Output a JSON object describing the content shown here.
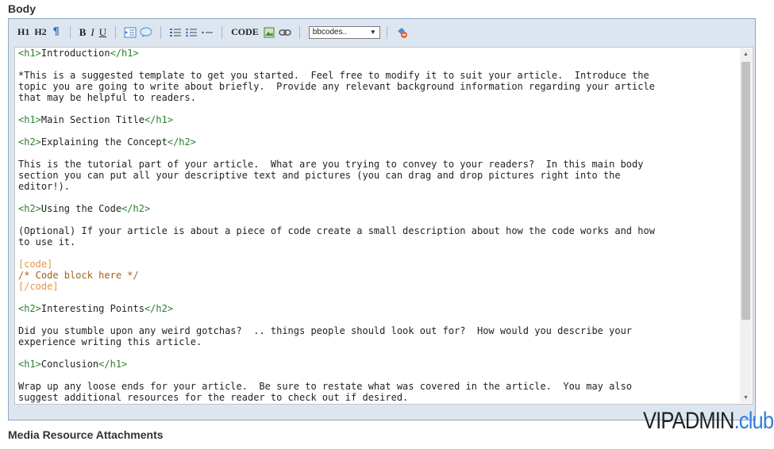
{
  "body_title": "Body",
  "media_title": "Media Resource Attachments",
  "toolbar": {
    "h1": "H1",
    "h2": "H2",
    "bold": "B",
    "italic": "I",
    "underline": "U",
    "code": "CODE",
    "select_value": "bbcodes.."
  },
  "editor_lines": [
    {
      "parts": [
        {
          "t": "<h1>",
          "c": "tag"
        },
        {
          "t": "Introduction"
        },
        {
          "t": "</h1>",
          "c": "tag"
        }
      ]
    },
    {
      "parts": []
    },
    {
      "parts": [
        {
          "t": "*This is a suggested template to get you started.  Feel free to modify it to suit your article.  Introduce the"
        }
      ]
    },
    {
      "parts": [
        {
          "t": "topic you are going to write about briefly.  Provide any relevant background information regarding your article"
        }
      ]
    },
    {
      "parts": [
        {
          "t": "that may be helpful to readers."
        }
      ]
    },
    {
      "parts": []
    },
    {
      "parts": [
        {
          "t": "<h1>",
          "c": "tag"
        },
        {
          "t": "Main Section Title"
        },
        {
          "t": "</h1>",
          "c": "tag"
        }
      ]
    },
    {
      "parts": []
    },
    {
      "parts": [
        {
          "t": "<h2>",
          "c": "tag"
        },
        {
          "t": "Explaining the Concept"
        },
        {
          "t": "</h2>",
          "c": "tag"
        }
      ]
    },
    {
      "parts": []
    },
    {
      "parts": [
        {
          "t": "This is the tutorial part of your article.  What are you trying to convey to your readers?  In this main body"
        }
      ]
    },
    {
      "parts": [
        {
          "t": "section you can put all your descriptive text and pictures (you can drag and drop pictures right into the"
        }
      ]
    },
    {
      "parts": [
        {
          "t": "editor!)."
        }
      ]
    },
    {
      "parts": []
    },
    {
      "parts": [
        {
          "t": "<h2>",
          "c": "tag"
        },
        {
          "t": "Using the Code"
        },
        {
          "t": "</h2>",
          "c": "tag"
        }
      ]
    },
    {
      "parts": []
    },
    {
      "parts": [
        {
          "t": "(Optional) If your article is about a piece of code create a small description about how the code works and how"
        }
      ]
    },
    {
      "parts": [
        {
          "t": "to use it."
        }
      ]
    },
    {
      "parts": []
    },
    {
      "parts": [
        {
          "t": "[code]",
          "c": "orange"
        }
      ]
    },
    {
      "parts": [
        {
          "t": "/* Code block here */",
          "c": "comment"
        }
      ]
    },
    {
      "parts": [
        {
          "t": "[/code]",
          "c": "orange"
        }
      ]
    },
    {
      "parts": []
    },
    {
      "parts": [
        {
          "t": "<h2>",
          "c": "tag"
        },
        {
          "t": "Interesting Points"
        },
        {
          "t": "</h2>",
          "c": "tag"
        }
      ]
    },
    {
      "parts": []
    },
    {
      "parts": [
        {
          "t": "Did you stumble upon any weird gotchas?  .. things people should look out for?  How would you describe your"
        }
      ]
    },
    {
      "parts": [
        {
          "t": "experience writing this article."
        }
      ]
    },
    {
      "parts": []
    },
    {
      "parts": [
        {
          "t": "<h1>",
          "c": "tag"
        },
        {
          "t": "Conclusion"
        },
        {
          "t": "</h1>",
          "c": "tag"
        }
      ]
    },
    {
      "parts": []
    },
    {
      "parts": [
        {
          "t": "Wrap up any loose ends for your article.  Be sure to restate what was covered in the article.  You may also"
        }
      ]
    },
    {
      "parts": [
        {
          "t": "suggest additional resources for the reader to check out if desired."
        }
      ]
    }
  ],
  "watermark": {
    "main": "VIPADMIN",
    "accent": ".club"
  },
  "colors": {
    "tag": "#2a7e2a",
    "code_tag": "#e0954a",
    "comment": "#a8601a",
    "toolbar_bg": "#dde6f0"
  }
}
